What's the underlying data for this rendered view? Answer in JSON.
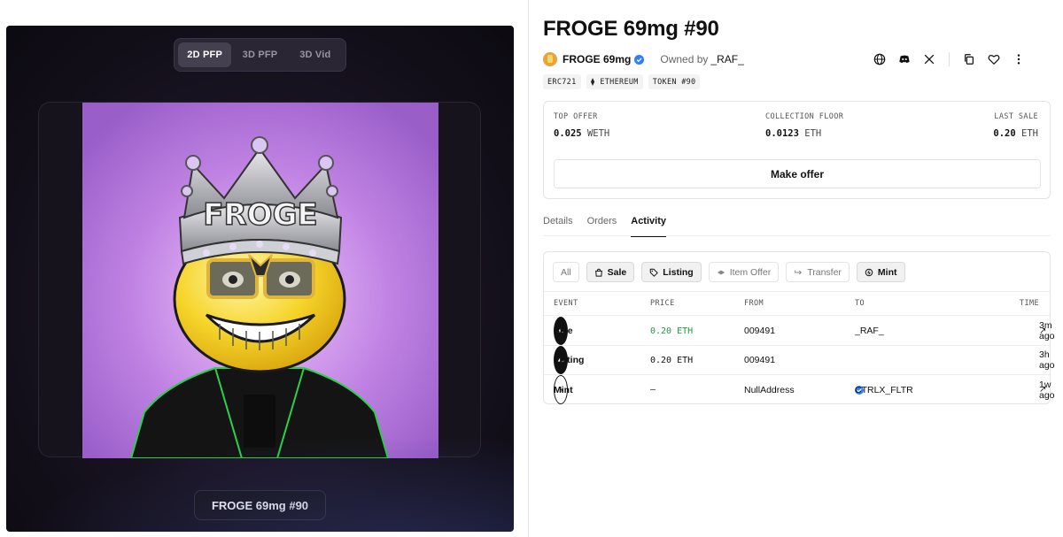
{
  "view_switch": {
    "tabs": [
      "2D PFP",
      "3D PFP",
      "3D Vid"
    ],
    "active": 0
  },
  "artwork": {
    "name_label": "FROGE 69mg #90",
    "crown_text": "FROGE"
  },
  "header": {
    "title": "FROGE 69mg #90",
    "collection": "FROGE 69mg",
    "owned_by_label": "Owned by",
    "owner": "_RAF_",
    "icons": [
      "globe-icon",
      "discord-icon",
      "x-icon",
      "copy-icon",
      "heart-icon",
      "more-icon"
    ]
  },
  "tags": [
    "ERC721",
    "⧫ ETHEREUM",
    "TOKEN #90"
  ],
  "stats": {
    "top_offer": {
      "label": "TOP OFFER",
      "value": "0.025",
      "unit": "WETH"
    },
    "collection_floor": {
      "label": "COLLECTION FLOOR",
      "value": "0.0123",
      "unit": "ETH"
    },
    "last_sale": {
      "label": "LAST SALE",
      "value": "0.20",
      "unit": "ETH"
    },
    "make_offer": "Make offer"
  },
  "tabs": {
    "details": "Details",
    "orders": "Orders",
    "activity": "Activity",
    "active": "Activity"
  },
  "filters": {
    "all": "All",
    "sale": "Sale",
    "listing": "Listing",
    "item_offer": "Item Offer",
    "transfer": "Transfer",
    "mint": "Mint"
  },
  "activity": {
    "headers": {
      "event": "EVENT",
      "price": "PRICE",
      "from": "FROM",
      "to": "TO",
      "time": "TIME"
    },
    "rows": [
      {
        "event": "Sale",
        "price": "0.20 ETH",
        "from": "009491",
        "to": "_RAF_",
        "time": "3m ago",
        "to_verified": false,
        "time_link": true
      },
      {
        "event": "Listing",
        "price": "0.20 ETH",
        "from": "009491",
        "to": "",
        "time": "3h ago",
        "to_verified": false,
        "time_link": false
      },
      {
        "event": "Mint",
        "price": "–",
        "from": "NullAddress",
        "to": "CTRLX_FLTR",
        "time": "1w ago",
        "to_verified": true,
        "time_link": true
      }
    ]
  },
  "colors": {
    "price_green": "#1f9a3f",
    "verified_blue": "#2f7ff5",
    "panel_dark": "#17121f",
    "art_purple": "#a86cd6"
  }
}
